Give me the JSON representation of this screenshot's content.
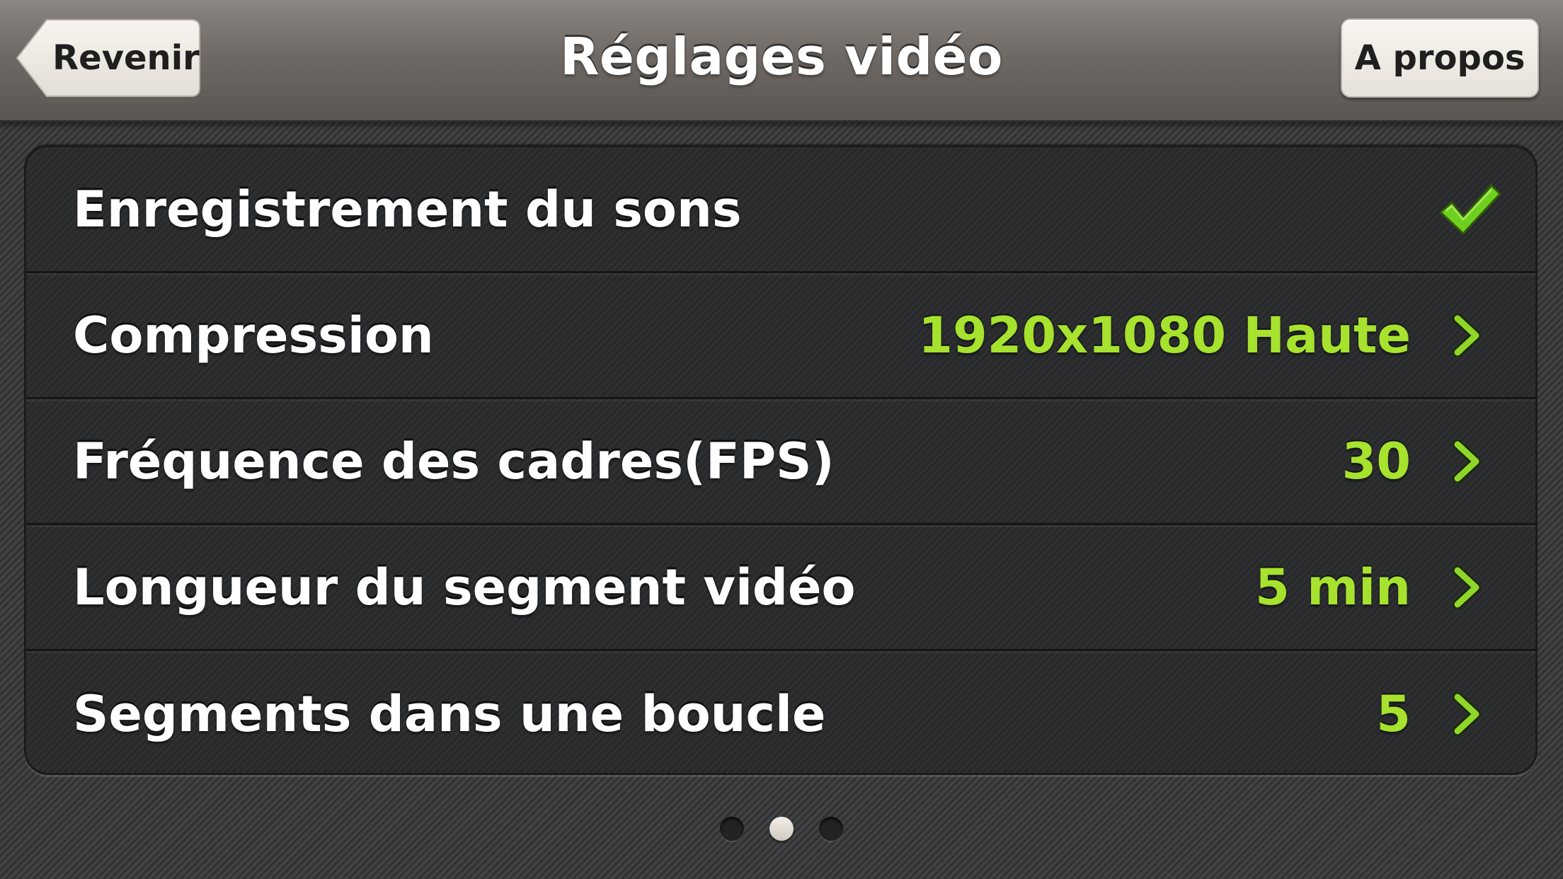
{
  "header": {
    "title": "Réglages vidéo",
    "back_label": "Revenir",
    "about_label": "A propos"
  },
  "settings": [
    {
      "label": "Enregistrement du sons",
      "value": "",
      "control": "checkmark-icon",
      "checked": true
    },
    {
      "label": "Compression",
      "value": "1920x1080 Haute",
      "control": "chevron-right-icon"
    },
    {
      "label": "Fréquence des cadres(FPS)",
      "value": "30",
      "control": "chevron-right-icon"
    },
    {
      "label": "Longueur du segment vidéo",
      "value": "5 min",
      "control": "chevron-right-icon"
    },
    {
      "label": "Segments dans une boucle",
      "value": "5",
      "control": "chevron-right-icon"
    }
  ],
  "pager": {
    "total_pages": 3,
    "current_page": 2
  },
  "colors": {
    "value_accent": "#a6e22e",
    "checkmark": "#6fcf1f"
  }
}
